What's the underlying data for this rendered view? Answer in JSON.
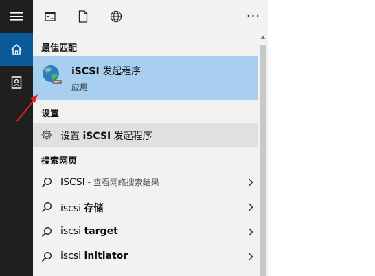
{
  "rail": {
    "items": [
      {
        "icon": "hamburger-menu-icon"
      },
      {
        "icon": "home-icon",
        "active": true
      },
      {
        "icon": "notebook-icon"
      }
    ]
  },
  "toolbar": {
    "icons": [
      "app-list-icon",
      "document-icon",
      "globe-icon"
    ],
    "more_label": "···"
  },
  "sections": {
    "best_match": "最佳匹配",
    "settings": "设置",
    "web": "搜索网页"
  },
  "best_match": {
    "title_bold": "iSCSI",
    "title_rest": " 发起程序",
    "subtitle": "应用",
    "icon": "iscsi-globe-icon"
  },
  "settings_item": {
    "prefix": "设置 ",
    "bold": "iSCSI",
    "suffix": " 发起程序",
    "icon": "gear-icon"
  },
  "web_items": [
    {
      "query": "ISCSI",
      "bold": "",
      "hint": " - 查看网络搜索结果"
    },
    {
      "query": "iscsi ",
      "bold": "存储",
      "hint": ""
    },
    {
      "query": "iscsi ",
      "bold": "target",
      "hint": ""
    },
    {
      "query": "iscsi ",
      "bold": "initiator",
      "hint": ""
    }
  ],
  "colors": {
    "rail_bg": "#1f1f1f",
    "rail_active": "#0a5a99",
    "panel_bg": "#f2f2f2",
    "best_match_bg": "#a9cff0",
    "setting_row_bg": "#e0e0e0",
    "annotation_arrow": "#e02020"
  }
}
